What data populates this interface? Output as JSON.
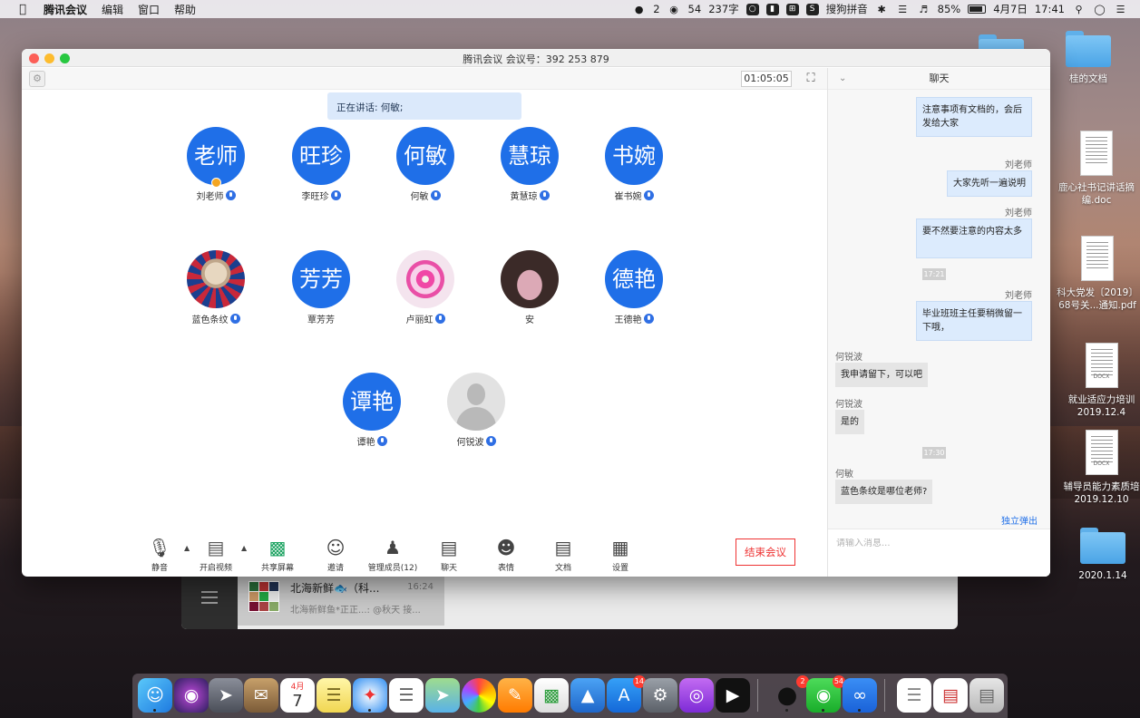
{
  "menubar": {
    "app_name": "腾讯会议",
    "menus": [
      "编辑",
      "窗口",
      "帮助"
    ],
    "qq_count": "2",
    "wechat_count": "54",
    "word_count": "237字",
    "input_method": "搜狗拼音",
    "battery": "85%",
    "date": "4月7日",
    "time": "17:41"
  },
  "desktop": {
    "icons": [
      {
        "label": "桂的文档"
      },
      {
        "label": "鹿心社书记讲话摘编.doc"
      },
      {
        "label": "科大党发〔2019〕68号关...通知.pdf"
      },
      {
        "label": "就业适应力培训2019.12.4",
        "tag": "DOCX"
      },
      {
        "label": "辅导员能力素质培2019.12.10",
        "tag": "DOCX"
      },
      {
        "label": "2020.1.14"
      }
    ]
  },
  "bg_window": {
    "chat_title": "北海新鲜🐟（科...",
    "chat_time": "16:24",
    "chat_preview": "北海新鲜鱼*正正...: @秋天 接..."
  },
  "meeting": {
    "title": "腾讯会议 会议号：392 253 879",
    "timer": "01:05:05",
    "speaking": "正在讲话: 何敏;",
    "participants": [
      {
        "avatar_text": "老师",
        "name": "刘老师",
        "host": true
      },
      {
        "avatar_text": "旺珍",
        "name": "李旺珍"
      },
      {
        "avatar_text": "何敏",
        "name": "何敏"
      },
      {
        "avatar_text": "慧琼",
        "name": "黄慧琼"
      },
      {
        "avatar_text": "书婉",
        "name": "崔书婉"
      },
      {
        "avatar_text": "",
        "name": "蓝色条纹"
      },
      {
        "avatar_text": "芳芳",
        "name": "覃芳芳"
      },
      {
        "avatar_text": "",
        "name": "卢丽虹"
      },
      {
        "avatar_text": "",
        "name": "安"
      },
      {
        "avatar_text": "德艳",
        "name": "王德艳"
      },
      {
        "avatar_text": "谭艳",
        "name": "谭艳"
      },
      {
        "avatar_text": "",
        "name": "何锐波"
      }
    ],
    "toolbar": {
      "mute": "静音",
      "video": "开启视频",
      "share": "共享屏幕",
      "invite": "邀请",
      "members": "管理成员(12)",
      "chat": "聊天",
      "emoji": "表情",
      "docs": "文档",
      "settings": "设置",
      "end": "结束会议"
    }
  },
  "chat": {
    "title": "聊天",
    "messages": [
      {
        "sender": "",
        "text": "注意事项有文档的，会后发给大家"
      },
      {
        "sender": "刘老师",
        "text": "大家先听一遍说明"
      },
      {
        "sender": "刘老师",
        "text": "要不然要注意的内容太多"
      },
      {
        "timestamp": "17:21"
      },
      {
        "sender": "刘老师",
        "text": "毕业班班主任要稍微留一下哦，"
      },
      {
        "sender": "何锐波",
        "text": "我申请留下，可以吧"
      },
      {
        "sender": "何锐波",
        "text": "是的"
      },
      {
        "timestamp": "17:30"
      },
      {
        "sender": "何敏",
        "text": "蓝色条纹是哪位老师?"
      }
    ],
    "popout": "独立弹出",
    "placeholder": "请输入消息..."
  },
  "dock": {
    "calendar_month": "4月",
    "calendar_day": "7",
    "badge_appstore": "14",
    "badge_qq": "2",
    "badge_wechat": "54"
  }
}
